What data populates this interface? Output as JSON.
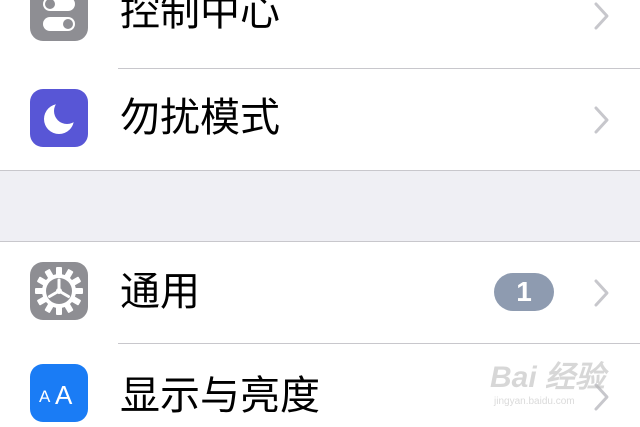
{
  "settings": {
    "rows": [
      {
        "label": "控制中心",
        "icon": "control-center-icon",
        "icon_color": "#8e8e93"
      },
      {
        "label": "勿扰模式",
        "icon": "moon-icon",
        "icon_color": "#5856d6"
      },
      {
        "label": "通用",
        "icon": "gear-icon",
        "icon_color": "#8e8e93",
        "badge": "1"
      },
      {
        "label": "显示与亮度",
        "icon": "text-size-icon",
        "icon_color": "#1a7cf5",
        "icon_text": "AA"
      }
    ]
  },
  "watermark": {
    "brand": "Bai 经验",
    "url": "jingyan.baidu.com"
  },
  "colors": {
    "grouped_background": "#efeff4",
    "separator": "#c8c7cc",
    "chevron": "#c7c7cc",
    "badge": "#8e9bb0"
  }
}
